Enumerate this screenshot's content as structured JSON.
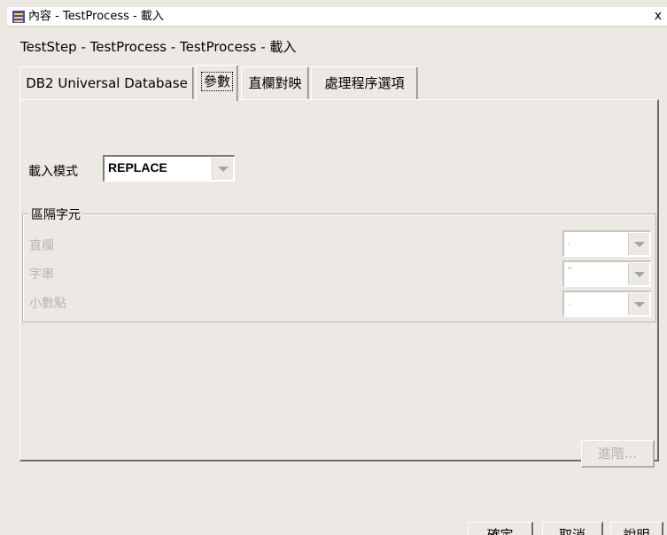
{
  "window": {
    "title": "內容 - TestProcess - 載入",
    "close_label": "x"
  },
  "header": {
    "subtitle": "TestStep - TestProcess - TestProcess - 載入"
  },
  "tabs": [
    {
      "label": "DB2 Universal Database",
      "active": false
    },
    {
      "label": "參數",
      "active": true
    },
    {
      "label": "直欄對映",
      "active": false
    },
    {
      "label": "處理程序選項",
      "active": false
    }
  ],
  "params": {
    "load_mode_label": "載入模式",
    "load_mode_value": "REPLACE",
    "delimiters": {
      "group_label": "區隔字元",
      "column_label": "直欄",
      "column_value": ",",
      "string_label": "字串",
      "string_value": "\"",
      "decimal_label": "小數點",
      "decimal_value": "."
    },
    "advanced_button": "進階..."
  },
  "footer": {
    "ok": "確定",
    "cancel": "取消",
    "help": "說明"
  }
}
